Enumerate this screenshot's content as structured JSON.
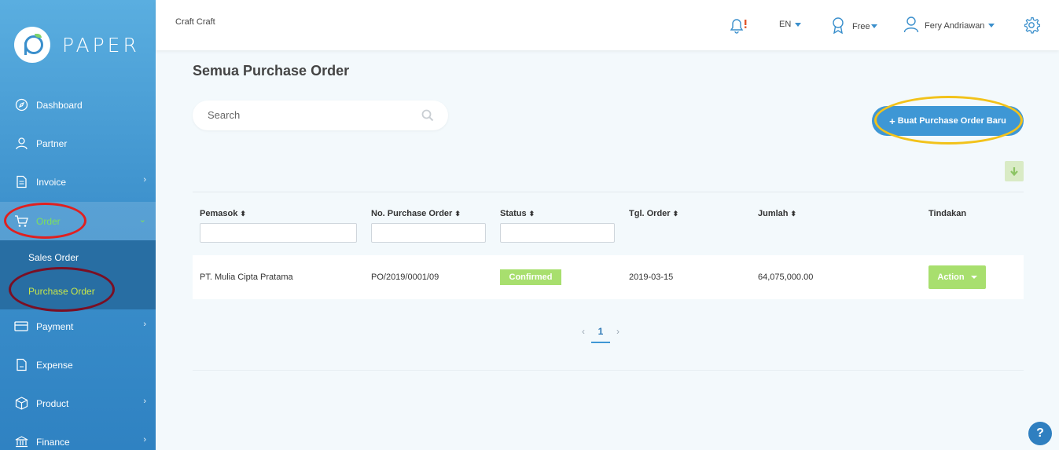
{
  "brand": {
    "name": "PAPER"
  },
  "sidebar": {
    "items": [
      {
        "label": "Dashboard",
        "icon": "compass-icon"
      },
      {
        "label": "Partner",
        "icon": "user-icon"
      },
      {
        "label": "Invoice",
        "icon": "document-icon"
      },
      {
        "label": "Order",
        "icon": "cart-icon"
      },
      {
        "label": "Payment",
        "icon": "card-icon"
      },
      {
        "label": "Expense",
        "icon": "file-icon"
      },
      {
        "label": "Product",
        "icon": "box-icon"
      },
      {
        "label": "Finance",
        "icon": "bank-icon"
      }
    ],
    "order_subitems": [
      {
        "label": "Sales Order"
      },
      {
        "label": "Purchase Order"
      }
    ]
  },
  "topbar": {
    "company": "Craft Craft",
    "language": "EN",
    "plan": "Free",
    "user": "Fery Andriawan",
    "icons": [
      "bell-alert-icon",
      "award-icon",
      "user-icon",
      "gear-icon"
    ]
  },
  "main": {
    "title": "Semua Purchase Order",
    "search_placeholder": "Search",
    "new_button_label": "Buat Purchase Order Baru",
    "table": {
      "columns": [
        "Pemasok",
        "No. Purchase Order",
        "Status",
        "Tgl. Order",
        "Jumlah",
        "Tindakan"
      ],
      "rows": [
        {
          "supplier": "PT. Mulia Cipta Pratama",
          "po_number": "PO/2019/0001/09",
          "status": "Confirmed",
          "date": "2019-03-15",
          "amount": "64,075,000.00",
          "action_label": "Action"
        }
      ]
    },
    "pagination": {
      "current": "1",
      "prev": "‹",
      "next": "›"
    }
  },
  "help_label": "?",
  "colors": {
    "primary": "#3e97d5",
    "success": "#a8df6e",
    "sidebar_active_text": "#7ee05c",
    "annotation_yellow": "#f2c21a",
    "annotation_red": "#e02020",
    "annotation_dark_red": "#7a0f24"
  }
}
